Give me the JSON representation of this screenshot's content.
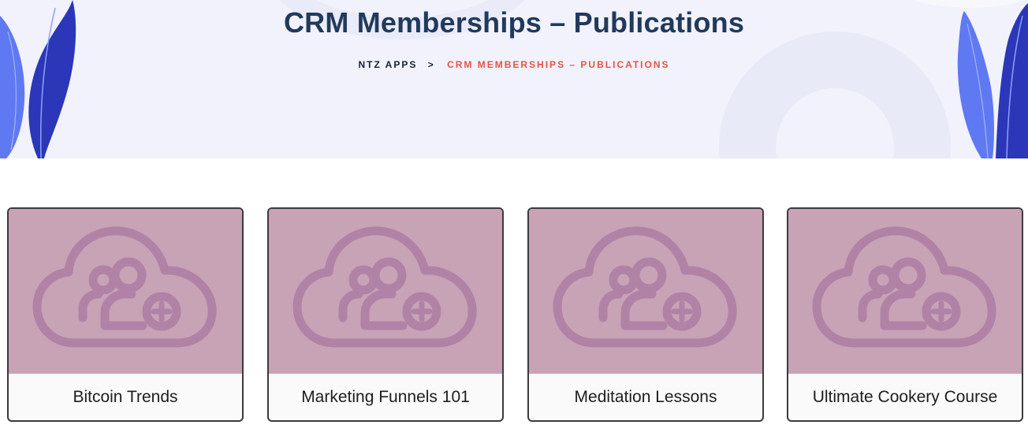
{
  "header": {
    "title": "CRM Memberships – Publications",
    "breadcrumb": {
      "home": "NTZ APPS",
      "separator": ">",
      "current": "CRM MEMBERSHIPS – PUBLICATIONS"
    }
  },
  "colors": {
    "title": "#213a5c",
    "breadcrumb_current": "#e9534a",
    "card_thumb_bg": "#c8a2b5",
    "card_icon": "#b083a6",
    "leaf_dark": "#2b37b8",
    "leaf_light": "#5f79f2"
  },
  "cards": [
    {
      "title": "Bitcoin Trends",
      "icon": "cloud-users-plus-icon"
    },
    {
      "title": "Marketing Funnels 101",
      "icon": "cloud-users-plus-icon"
    },
    {
      "title": "Meditation Lessons",
      "icon": "cloud-users-plus-icon"
    },
    {
      "title": "Ultimate Cookery Course",
      "icon": "cloud-users-plus-icon"
    }
  ]
}
